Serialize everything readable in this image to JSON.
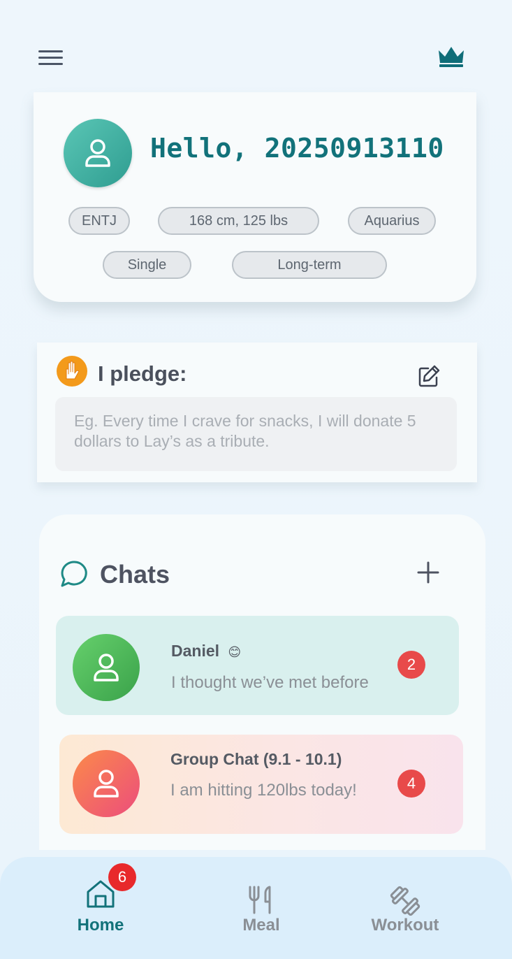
{
  "colors": {
    "accent_teal": "#12727a",
    "badge_red": "#e84a4a",
    "nav_active": "#12727a",
    "nav_inactive": "#8a8f95"
  },
  "header": {
    "menu_icon": "hamburger-menu-icon",
    "crown_icon": "crown-icon"
  },
  "profile": {
    "greeting": "Hello, 20250913110",
    "avatar_icon": "user-icon",
    "tags": [
      "ENTJ",
      "168 cm, 125 lbs",
      "Aquarius",
      "Single",
      "Long-term"
    ]
  },
  "pledge": {
    "icon": "raised-hand-icon",
    "title": "I pledge:",
    "edit_icon": "edit-icon",
    "placeholder": "Eg. Every time I crave for snacks, I will donate 5 dollars to Lay’s as a tribute."
  },
  "chats": {
    "icon": "chat-bubble-icon",
    "title": "Chats",
    "add_icon": "plus-icon",
    "items": [
      {
        "name": "Daniel",
        "emoji": "😊",
        "message": "I thought we’ve met before",
        "unread": "2"
      },
      {
        "name": "Group Chat (9.1 - 10.1)",
        "message": "I am hitting 120lbs today!",
        "unread": "4"
      }
    ]
  },
  "nav": {
    "badge": "6",
    "items": [
      {
        "label": "Home",
        "icon": "home-icon",
        "active": true
      },
      {
        "label": "Meal",
        "icon": "fork-knife-icon",
        "active": false
      },
      {
        "label": "Workout",
        "icon": "dumbbell-icon",
        "active": false
      }
    ]
  }
}
